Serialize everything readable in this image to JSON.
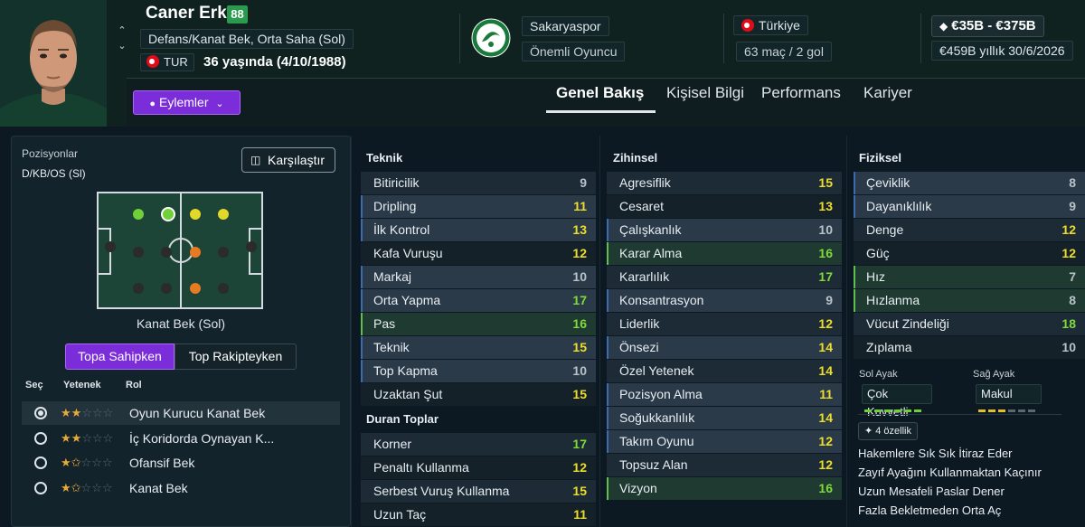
{
  "player": {
    "name": "Caner Erkin",
    "ca": "88",
    "positions": "Defans/Kanat Bek, Orta Saha (Sol)",
    "nationality_code": "TUR",
    "age_line": "36 yaşında (4/10/1988)",
    "actions_label": "Eylemler"
  },
  "club": {
    "name": "Sakaryaspor",
    "status": "Önemli Oyuncu"
  },
  "international": {
    "country": "Türkiye",
    "caps": "63 maç / 2 gol"
  },
  "contract": {
    "value": "€35B - €375B",
    "wage": "€459B yıllık 30/6/2026"
  },
  "tabs": [
    "Genel Bakış",
    "Kişisel Bilgi",
    "Performans",
    "Kariyer"
  ],
  "positions_panel": {
    "title": "Pozisyonlar",
    "code": "D/KB/OS (Sl)",
    "compare_label": "Karşılaştır",
    "selected_position": "Kanat Bek (Sol)",
    "toggle_with_ball": "Topa Sahipken",
    "toggle_without_ball": "Top Rakipteyken",
    "hdr_select": "Seç",
    "hdr_ability": "Yetenek",
    "hdr_role": "Rol",
    "roles": [
      {
        "name": "Oyun Kurucu Kanat Bek",
        "stars": 2,
        "selected": true
      },
      {
        "name": "İç Koridorda Oynayan K...",
        "stars": 2,
        "selected": false
      },
      {
        "name": "Ofansif Bek",
        "stars": 1.5,
        "selected": false
      },
      {
        "name": "Kanat Bek",
        "stars": 1.5,
        "selected": false
      }
    ]
  },
  "colors": {
    "accent_purple": "#7a2dd8",
    "rating_grey": "#b8c2c8",
    "rating_yellow": "#eedd2a",
    "rating_green": "#7fda3a",
    "pitch_green": "#1c4437"
  },
  "technical": {
    "title": "Teknik",
    "items": [
      {
        "name": "Bitiricilik",
        "value": "9"
      },
      {
        "name": "Dripling",
        "value": "11"
      },
      {
        "name": "İlk Kontrol",
        "value": "13"
      },
      {
        "name": "Kafa Vuruşu",
        "value": "12"
      },
      {
        "name": "Markaj",
        "value": "10"
      },
      {
        "name": "Orta Yapma",
        "value": "17"
      },
      {
        "name": "Pas",
        "value": "16"
      },
      {
        "name": "Teknik",
        "value": "15"
      },
      {
        "name": "Top Kapma",
        "value": "10"
      },
      {
        "name": "Uzaktan Şut",
        "value": "15"
      }
    ]
  },
  "set_pieces": {
    "title": "Duran Toplar",
    "items": [
      {
        "name": "Korner",
        "value": "17"
      },
      {
        "name": "Penaltı Kullanma",
        "value": "12"
      },
      {
        "name": "Serbest Vuruş Kullanma",
        "value": "15"
      },
      {
        "name": "Uzun Taç",
        "value": "11"
      }
    ]
  },
  "mental": {
    "title": "Zihinsel",
    "items": [
      {
        "name": "Agresiflik",
        "value": "15"
      },
      {
        "name": "Cesaret",
        "value": "13"
      },
      {
        "name": "Çalışkanlık",
        "value": "10"
      },
      {
        "name": "Karar Alma",
        "value": "16"
      },
      {
        "name": "Kararlılık",
        "value": "17"
      },
      {
        "name": "Konsantrasyon",
        "value": "9"
      },
      {
        "name": "Liderlik",
        "value": "12"
      },
      {
        "name": "Önsezi",
        "value": "14"
      },
      {
        "name": "Özel Yetenek",
        "value": "14"
      },
      {
        "name": "Pozisyon Alma",
        "value": "11"
      },
      {
        "name": "Soğukkanlılık",
        "value": "14"
      },
      {
        "name": "Takım Oyunu",
        "value": "12"
      },
      {
        "name": "Topsuz Alan",
        "value": "12"
      },
      {
        "name": "Vizyon",
        "value": "16"
      }
    ]
  },
  "physical": {
    "title": "Fiziksel",
    "items": [
      {
        "name": "Çeviklik",
        "value": "8"
      },
      {
        "name": "Dayanıklılık",
        "value": "9"
      },
      {
        "name": "Denge",
        "value": "12"
      },
      {
        "name": "Güç",
        "value": "12"
      },
      {
        "name": "Hız",
        "value": "7"
      },
      {
        "name": "Hızlanma",
        "value": "8"
      },
      {
        "name": "Vücut Zindeliği",
        "value": "18"
      },
      {
        "name": "Zıplama",
        "value": "10"
      }
    ]
  },
  "feet": {
    "left_label": "Sol Ayak",
    "left_value": "Çok Kuvvetli",
    "right_label": "Sağ Ayak",
    "right_value": "Makul"
  },
  "traits": {
    "count_label": "4 özellik",
    "items": [
      "Hakemlere Sık Sık İtiraz Eder",
      "Zayıf Ayağını Kullanmaktan Kaçınır",
      "Uzun Mesafeli Paslar Dener",
      "Fazla Bekletmeden Orta Aç"
    ]
  }
}
